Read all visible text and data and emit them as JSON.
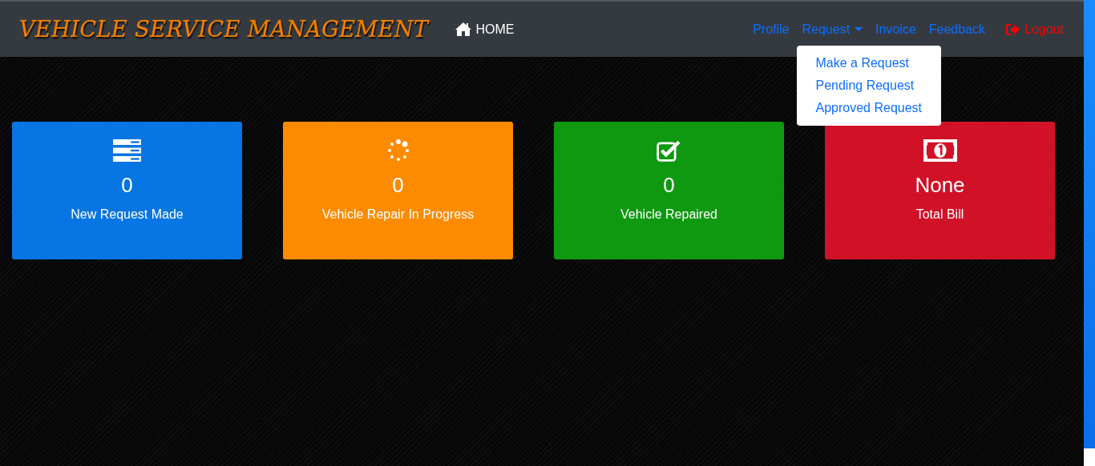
{
  "navbar": {
    "brand": "VEHICLE SERVICE MANAGEMENT",
    "home": "HOME",
    "links": [
      {
        "label": "Profile",
        "kind": "link"
      },
      {
        "label": "Request",
        "kind": "dropdown",
        "expanded": true,
        "items": [
          "Make a Request",
          "Pending Request",
          "Approved Request"
        ]
      },
      {
        "label": "Invoice",
        "kind": "link"
      },
      {
        "label": "Feedback",
        "kind": "link"
      }
    ],
    "logout": "Logout"
  },
  "cards": [
    {
      "kind": "list",
      "value": "0",
      "label": "New Request Made",
      "color": "#0775e3"
    },
    {
      "kind": "spinner",
      "value": "0",
      "label": "Vehicle Repair In Progress",
      "color": "#fd8b00"
    },
    {
      "kind": "check",
      "value": "0",
      "label": "Vehicle Repaired",
      "color": "#0f9911"
    },
    {
      "kind": "money",
      "value": "None",
      "label": "Total Bill",
      "color": "#d01127"
    }
  ]
}
